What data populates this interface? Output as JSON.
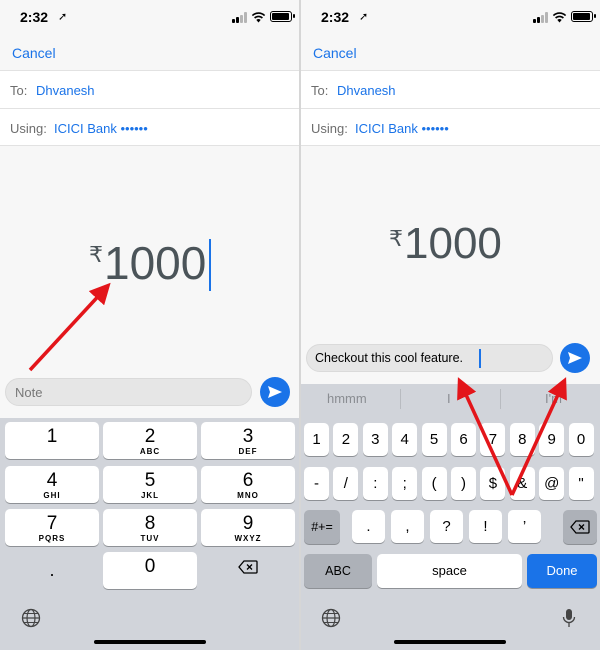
{
  "status": {
    "time": "2:32",
    "loc_glyph": "➚"
  },
  "nav": {
    "cancel_label": "Cancel"
  },
  "form": {
    "to_label": "To:",
    "to_value": "Dhvanesh",
    "using_label": "Using:",
    "using_value": "ICICI Bank ••••••"
  },
  "payment": {
    "currency": "₹",
    "amount": "1000"
  },
  "left_panel": {
    "note_placeholder": "Note",
    "keypad": [
      {
        "digit": "1",
        "letters": ""
      },
      {
        "digit": "2",
        "letters": "ABC"
      },
      {
        "digit": "3",
        "letters": "DEF"
      },
      {
        "digit": "4",
        "letters": "GHI"
      },
      {
        "digit": "5",
        "letters": "JKL"
      },
      {
        "digit": "6",
        "letters": "MNO"
      },
      {
        "digit": "7",
        "letters": "PQRS"
      },
      {
        "digit": "8",
        "letters": "TUV"
      },
      {
        "digit": "9",
        "letters": "WXYZ"
      },
      {
        "digit": ".",
        "letters": ""
      },
      {
        "digit": "0",
        "letters": ""
      },
      {
        "digit": "⌫",
        "letters": ""
      }
    ]
  },
  "right_panel": {
    "message_text": "Checkout this cool feature.",
    "suggestions": [
      "hmmm",
      "I",
      "I'm"
    ],
    "row1": [
      "1",
      "2",
      "3",
      "4",
      "5",
      "6",
      "7",
      "8",
      "9",
      "0"
    ],
    "row2": [
      "-",
      "/",
      ":",
      ";",
      "(",
      ")",
      "$",
      "&",
      "@",
      "\""
    ],
    "row3_shift": "#+=",
    "row3": [
      ".",
      ",",
      "?",
      "!",
      "’"
    ],
    "abc_label": "ABC",
    "space_label": "space",
    "done_label": "Done"
  },
  "colors": {
    "accent": "#1a73e8",
    "arrow": "#e3151a",
    "keyboard_bg": "#d1d4da"
  },
  "icons": [
    "send-icon",
    "globe-icon",
    "microphone-icon",
    "backspace-icon",
    "wifi-icon",
    "battery-icon",
    "signal-icon",
    "location-arrow-icon"
  ]
}
